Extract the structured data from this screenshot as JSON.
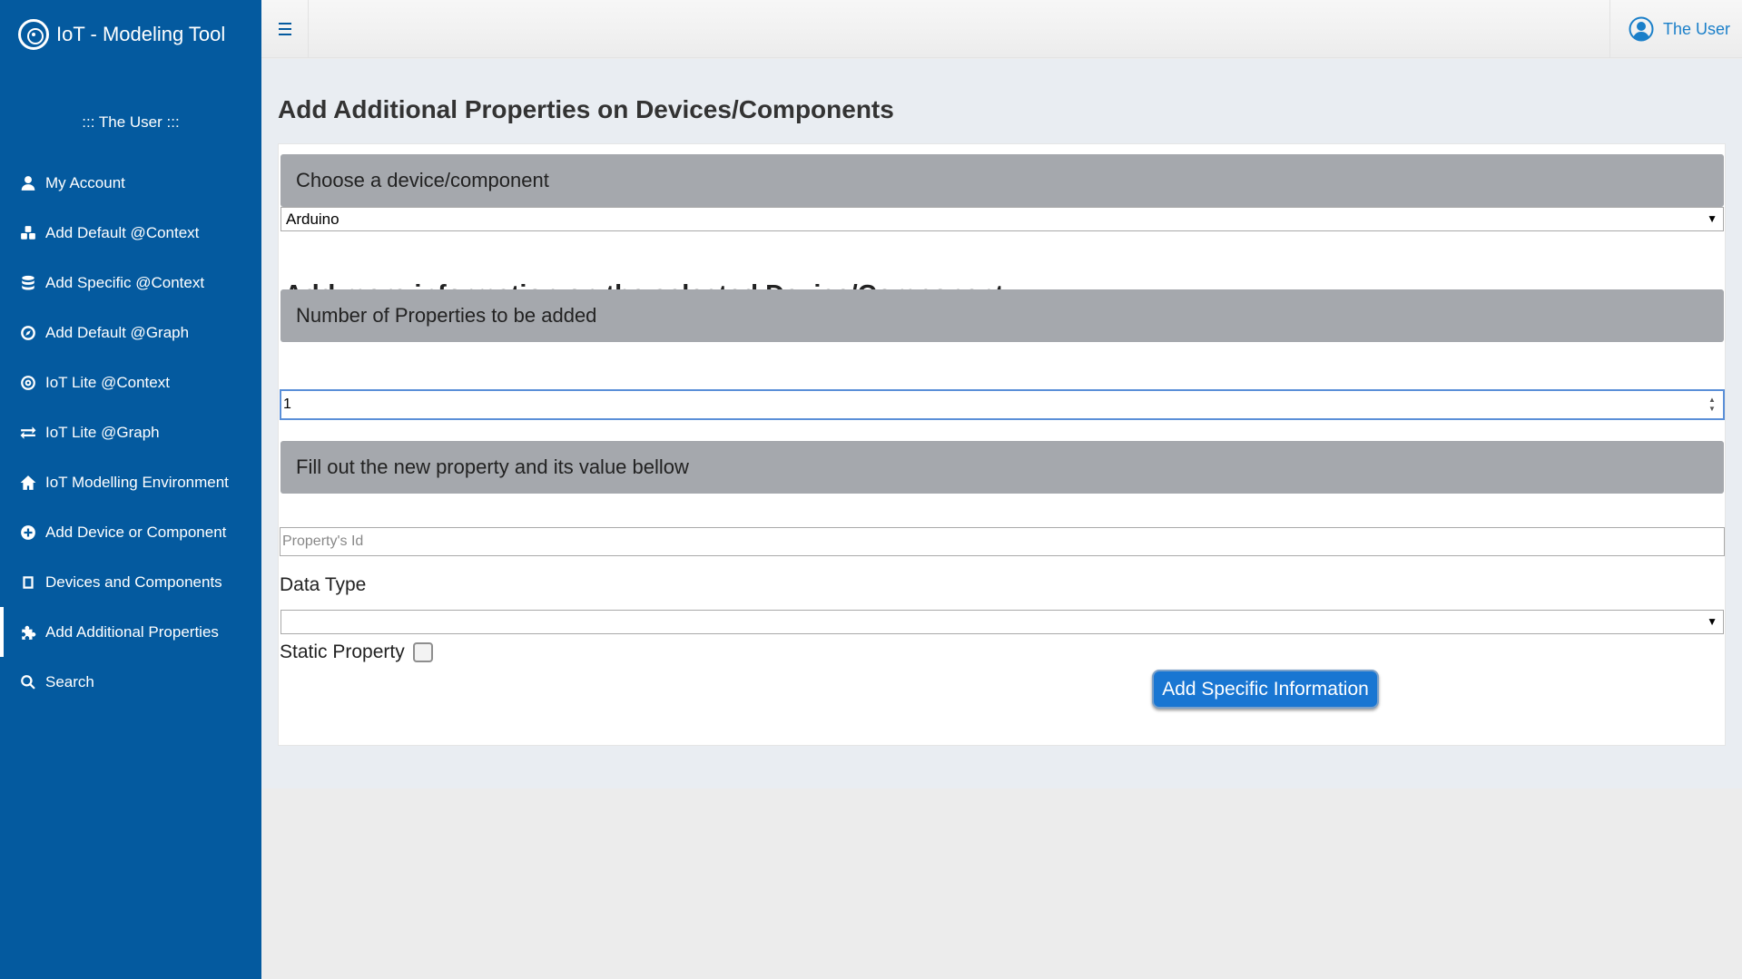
{
  "app": {
    "title": "IoT - Modeling Tool",
    "user_line": "::: The User :::"
  },
  "topbar": {
    "user_name": "The User"
  },
  "sidebar": {
    "items": [
      {
        "label": "My Account",
        "icon": "user-icon"
      },
      {
        "label": "Add Default @Context",
        "icon": "cubes-icon"
      },
      {
        "label": "Add Specific @Context",
        "icon": "database-icon"
      },
      {
        "label": "Add Default @Graph",
        "icon": "compass-icon"
      },
      {
        "label": "IoT Lite @Context",
        "icon": "bullseye-icon"
      },
      {
        "label": "IoT Lite @Graph",
        "icon": "exchange-icon"
      },
      {
        "label": "IoT Modelling Environment",
        "icon": "home-icon"
      },
      {
        "label": "Add Device or Component",
        "icon": "plus-circle-icon"
      },
      {
        "label": "Devices and Components",
        "icon": "square-icon"
      },
      {
        "label": "Add Additional Properties",
        "icon": "puzzle-icon",
        "active": true
      },
      {
        "label": "Search",
        "icon": "search-icon"
      }
    ]
  },
  "main": {
    "page_title": "Add Additional Properties on Devices/Components",
    "choose_header": "Choose a device/component",
    "device_select_value": "Arduino",
    "section_title": "Add more information on the selected Device/Component",
    "num_props_header": "Number of Properties to be added",
    "num_props_value": "1",
    "fill_header": "Fill out the new property and its value bellow",
    "property_id_placeholder": "Property's Id",
    "data_type_label": "Data Type",
    "data_type_value": "",
    "static_property_label": "Static Property",
    "static_property_checked": false,
    "submit_label": "Add Specific Information"
  },
  "colors": {
    "sidebar_bg": "#045a9f",
    "panel_header_bg": "#a5a8ad",
    "button_bg": "#1976d2",
    "user_link": "#1a7fc9"
  }
}
